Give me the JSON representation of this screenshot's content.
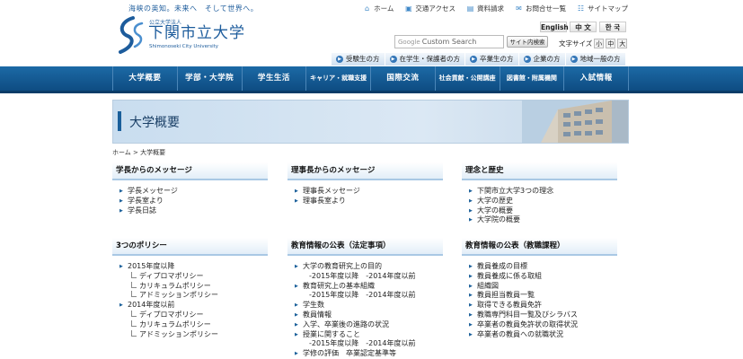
{
  "header": {
    "tagline": "海峡の英知。未来へ　そして世界へ。",
    "logo_small": "公立大学法人",
    "logo_name": "下関市立大学",
    "logo_en": "Shimonoseki City University",
    "top_links": [
      {
        "label": "ホーム",
        "icon": "home-icon"
      },
      {
        "label": "交通アクセス",
        "icon": "bus-icon"
      },
      {
        "label": "資料請求",
        "icon": "document-icon"
      },
      {
        "label": "お問合せ一覧",
        "icon": "mail-icon"
      },
      {
        "label": "サイトマップ",
        "icon": "sitemap-icon"
      }
    ],
    "languages": [
      "English",
      "中 文",
      "한 국"
    ],
    "search_placeholder": "Custom Search",
    "search_brand": "Google",
    "search_button": "サイト内検索",
    "font_size_label": "文字サイズ",
    "font_sizes": [
      "小",
      "中",
      "大"
    ],
    "audiences": [
      "受験生の方",
      "在学生・保護者の方",
      "卒業生の方",
      "企業の方",
      "地域一般の方"
    ]
  },
  "nav": [
    "大学概要",
    "学部・大学院",
    "学生生活",
    "キャリア・就職支援",
    "国際交流",
    "社会貢献・公開講座",
    "図書館・附属機関",
    "入試情報"
  ],
  "banner_title": "大学概要",
  "breadcrumb": "ホーム > 大学概要",
  "panels": [
    {
      "title": "学長からのメッセージ",
      "items": [
        {
          "t": "学長メッセージ",
          "k": "top"
        },
        {
          "t": "学長室より",
          "k": "top"
        },
        {
          "t": "学長日誌",
          "k": "top"
        }
      ]
    },
    {
      "title": "理事長からのメッセージ",
      "items": [
        {
          "t": "理事長メッセージ",
          "k": "top"
        },
        {
          "t": "理事長室より",
          "k": "top"
        }
      ]
    },
    {
      "title": "理念と歴史",
      "items": [
        {
          "t": "下関市立大学3つの理念",
          "k": "top"
        },
        {
          "t": "大学の歴史",
          "k": "top"
        },
        {
          "t": "大学の概要",
          "k": "top"
        },
        {
          "t": "大学院の概要",
          "k": "top"
        }
      ]
    },
    {
      "title": "3つのポリシー",
      "items": [
        {
          "t": "2015年度以降",
          "k": "top"
        },
        {
          "t": "ディプロマポリシー",
          "k": "sub"
        },
        {
          "t": "カリキュラムポリシー",
          "k": "sub"
        },
        {
          "t": "アドミッションポリシー",
          "k": "sub"
        },
        {
          "t": "2014年度以前",
          "k": "top"
        },
        {
          "t": "ディプロマポリシー",
          "k": "sub"
        },
        {
          "t": "カリキュラムポリシー",
          "k": "sub"
        },
        {
          "t": "アドミッションポリシー",
          "k": "sub"
        }
      ]
    },
    {
      "title": "教育情報の公表（法定事項）",
      "items": [
        {
          "t": "大学の教育研究上の目的",
          "k": "top"
        },
        {
          "t": "-2015年度以降　-2014年度以前",
          "k": "cont"
        },
        {
          "t": "教育研究上の基本組織",
          "k": "top"
        },
        {
          "t": "-2015年度以降　-2014年度以前",
          "k": "cont"
        },
        {
          "t": "学生数",
          "k": "top"
        },
        {
          "t": "教員情報",
          "k": "top"
        },
        {
          "t": "入学、卒業後の進路の状況",
          "k": "top"
        },
        {
          "t": "授業に関すること",
          "k": "top"
        },
        {
          "t": "-2015年度以降　-2014年度以前",
          "k": "cont"
        },
        {
          "t": "学修の評価　卒業認定基準等",
          "k": "top"
        }
      ]
    },
    {
      "title": "教育情報の公表（教職課程）",
      "items": [
        {
          "t": "教員養成の目標",
          "k": "top"
        },
        {
          "t": "教員養成に係る取組",
          "k": "top"
        },
        {
          "t": "組織図",
          "k": "top"
        },
        {
          "t": "教員担当教員一覧",
          "k": "top"
        },
        {
          "t": "取得できる教員免許",
          "k": "top"
        },
        {
          "t": "教職専門科目一覧及びシラバス",
          "k": "top"
        },
        {
          "t": "卒業者の教員免許状の取得状況",
          "k": "top"
        },
        {
          "t": "卒業者の教員への就職状況",
          "k": "top"
        }
      ]
    }
  ]
}
